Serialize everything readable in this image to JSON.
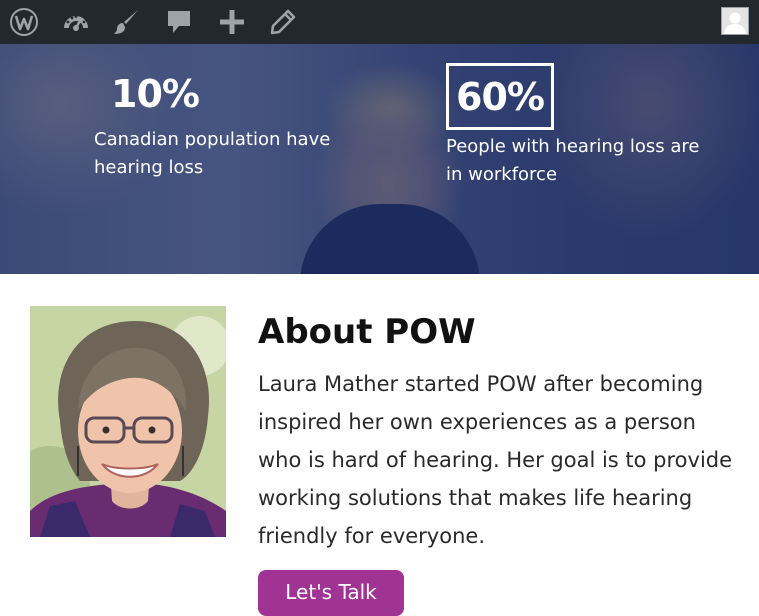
{
  "admin_bar": {
    "icons": [
      "wordpress-icon",
      "dashboard-icon",
      "customize-icon",
      "comments-icon",
      "new-content-icon",
      "edit-icon"
    ],
    "background": "#23282d"
  },
  "hero": {
    "overlay_color": "#1c2c64",
    "stats": [
      {
        "value": "10%",
        "label": "Canadian population have hearing loss"
      },
      {
        "value": "60%",
        "label": "People with hearing loss are in workforce"
      }
    ]
  },
  "about": {
    "title": "About POW",
    "text": "Laura Mather started POW after becoming inspired her own experiences as a person who is hard of hearing. Her goal is to provide working solutions that makes life hearing friendly for everyone.",
    "cta_label": "Let's Talk",
    "cta_color": "#a03393"
  }
}
